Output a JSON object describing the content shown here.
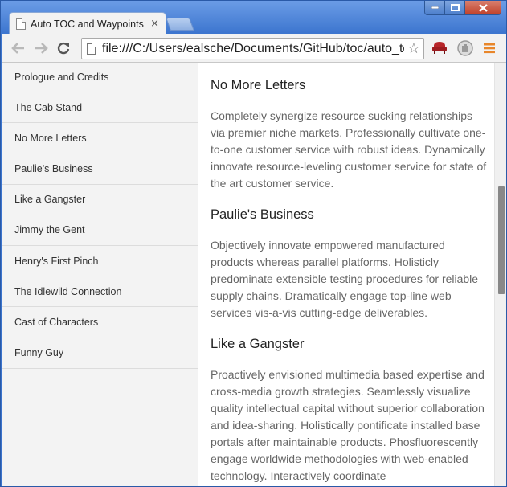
{
  "window": {
    "controls": [
      "minimize",
      "maximize",
      "close"
    ]
  },
  "tab": {
    "title": "Auto TOC and Waypoints",
    "close_glyph": "×"
  },
  "toolbar": {
    "back_icon": "back-arrow-icon",
    "forward_icon": "forward-arrow-icon",
    "reload_icon": "reload-icon",
    "url": "file:///C:/Users/ealsche/Documents/GitHub/toc/auto_toc.html",
    "star_glyph": "☆",
    "extensions": [
      "sofa-extension-icon",
      "hand-extension-icon"
    ],
    "menu_icon": "hamburger-menu-icon"
  },
  "toc": {
    "items": [
      "Prologue and Credits",
      "The Cab Stand",
      "No More Letters",
      "Paulie's Business",
      "Like a Gangster",
      "Jimmy the Gent",
      "Henry's First Pinch",
      "The Idlewild Connection",
      "Cast of Characters",
      "Funny Guy"
    ]
  },
  "article": {
    "sections": [
      {
        "heading": "No More Letters",
        "body": "Completely synergize resource sucking relationships via premier niche markets. Professionally cultivate one-to-one customer service with robust ideas. Dynamically innovate resource-leveling customer service for state of the art customer service."
      },
      {
        "heading": "Paulie's Business",
        "body": "Objectively innovate empowered manufactured products whereas parallel platforms. Holisticly predominate extensible testing procedures for reliable supply chains. Dramatically engage top-line web services vis-a-vis cutting-edge deliverables."
      },
      {
        "heading": "Like a Gangster",
        "body": "Proactively envisioned multimedia based expertise and cross-media growth strategies. Seamlessly visualize quality intellectual capital without superior collaboration and idea-sharing. Holistically pontificate installed base portals after maintainable products. Phosfluorescently engage worldwide methodologies with web-enabled technology. Interactively coordinate"
      }
    ]
  },
  "colors": {
    "chrome_blue": "#3f79d4",
    "toolbar_bg": "#f2f2f2",
    "toc_bg": "#f3f3f3",
    "menu_orange": "#e8862a",
    "extension_red": "#b8262a"
  }
}
